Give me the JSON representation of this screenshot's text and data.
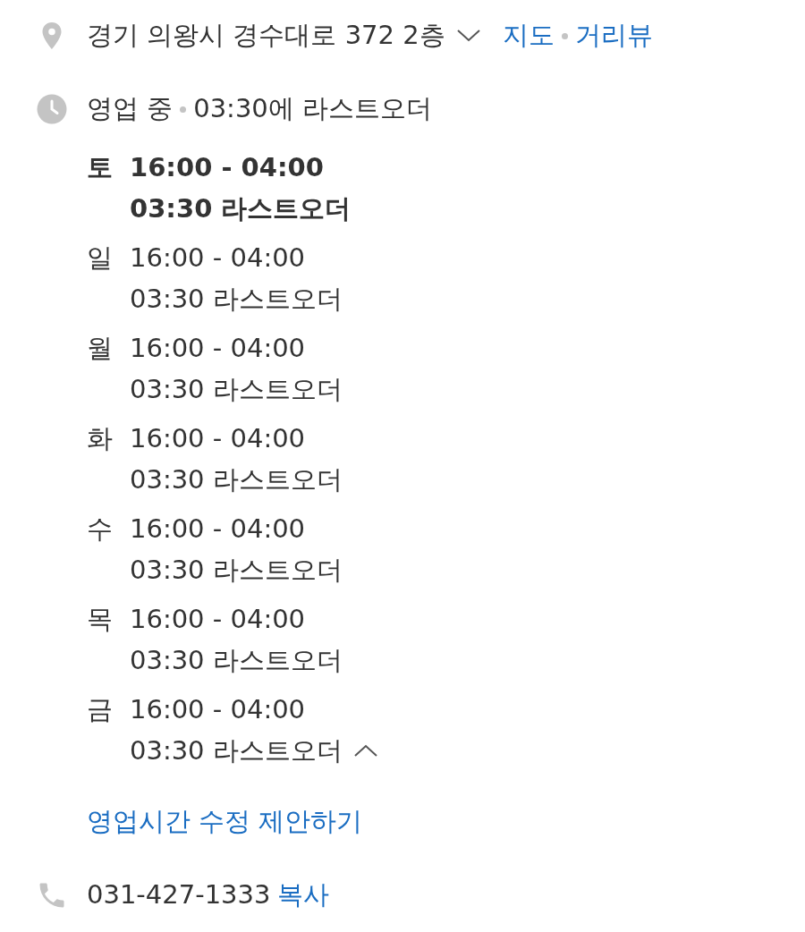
{
  "address": {
    "text": "경기 의왕시 경수대로 372 2층",
    "expanded": false,
    "links": [
      "지도",
      "거리뷰"
    ]
  },
  "hours": {
    "status": "영업 중",
    "note": "03:30에 라스트오더",
    "expanded": true,
    "days": [
      {
        "day": "토",
        "time": "16:00 - 04:00",
        "last_order": "03:30 라스트오더",
        "selected": true
      },
      {
        "day": "일",
        "time": "16:00 - 04:00",
        "last_order": "03:30 라스트오더",
        "selected": false
      },
      {
        "day": "월",
        "time": "16:00 - 04:00",
        "last_order": "03:30 라스트오더",
        "selected": false
      },
      {
        "day": "화",
        "time": "16:00 - 04:00",
        "last_order": "03:30 라스트오더",
        "selected": false
      },
      {
        "day": "수",
        "time": "16:00 - 04:00",
        "last_order": "03:30 라스트오더",
        "selected": false
      },
      {
        "day": "목",
        "time": "16:00 - 04:00",
        "last_order": "03:30 라스트오더",
        "selected": false
      },
      {
        "day": "금",
        "time": "16:00 - 04:00",
        "last_order": "03:30 라스트오더",
        "selected": false
      }
    ],
    "suggest_link": "영업시간 수정 제안하기"
  },
  "phone": {
    "number": "031-427-1333",
    "copy": "복사"
  }
}
